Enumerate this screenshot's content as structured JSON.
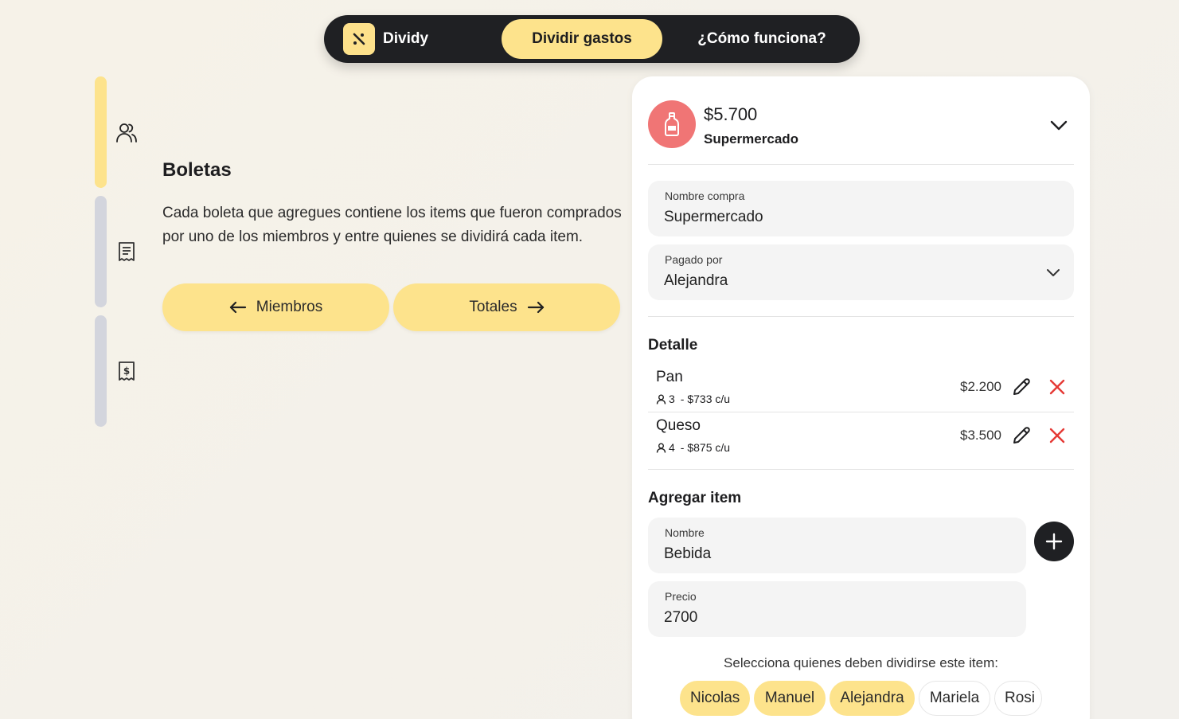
{
  "nav": {
    "brand": "Dividy",
    "tab_active": "Dividir gastos",
    "tab_how": "¿Cómo funciona?"
  },
  "stepper": {
    "steps": [
      {
        "icon": "users-icon",
        "active": true
      },
      {
        "icon": "receipt-icon",
        "active": false
      },
      {
        "icon": "receipt-dollar-icon",
        "active": false
      }
    ]
  },
  "section": {
    "title": "Boletas",
    "description": "Cada boleta que agregues contiene los items que fueron comprados por uno de los miembros y entre quienes se dividirá cada item.",
    "back_label": "Miembros",
    "next_label": "Totales"
  },
  "receipt": {
    "total": "$5.700",
    "category": "Supermercado",
    "name_label": "Nombre compra",
    "name_value": "Supermercado",
    "paid_by_label": "Pagado por",
    "paid_by_value": "Alejandra",
    "detail_title": "Detalle",
    "items": [
      {
        "name": "Pan",
        "people": "3",
        "per_person": "- $733 c/u",
        "price": "$2.200"
      },
      {
        "name": "Queso",
        "people": "4",
        "per_person": "- $875 c/u",
        "price": "$3.500"
      }
    ],
    "add_title": "Agregar item",
    "new_name_label": "Nombre",
    "new_name_value": "Bebida",
    "new_price_label": "Precio",
    "new_price_value": "2700",
    "select_hint": "Selecciona quienes deben dividirse este item:",
    "members": [
      {
        "name": "Nicolas",
        "selected": true
      },
      {
        "name": "Manuel",
        "selected": true
      },
      {
        "name": "Alejandra",
        "selected": true
      },
      {
        "name": "Mariela",
        "selected": false
      },
      {
        "name": "Rosi",
        "selected": false
      }
    ]
  },
  "colors": {
    "accent": "#fde38c",
    "dark": "#1f2023",
    "category": "#f07575",
    "delete": "#e53935"
  }
}
